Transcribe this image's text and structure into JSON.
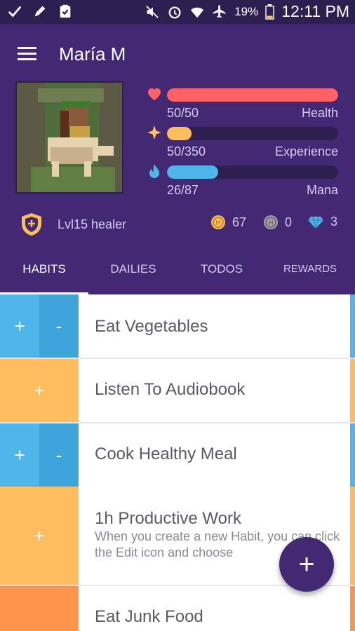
{
  "status_bar": {
    "battery_percent": "19%",
    "time": "12:11 PM"
  },
  "header": {
    "user_name": "María M",
    "stats": {
      "health": {
        "value": "50/50",
        "label": "Health",
        "fraction": 1.0,
        "color": "#ff6165"
      },
      "experience": {
        "value": "50/350",
        "label": "Experience",
        "fraction": 0.143,
        "color": "#ffbe5d"
      },
      "mana": {
        "value": "26/87",
        "label": "Mana",
        "fraction": 0.299,
        "color": "#50b5e9"
      }
    },
    "class_label": "Lvl15 healer",
    "gold": "67",
    "hourglasses": "0",
    "gems": "3"
  },
  "tabs": [
    "HABITS",
    "DAILIES",
    "TODOS",
    "REWARDS"
  ],
  "active_tab": "HABITS",
  "habits": [
    {
      "title": "Eat Vegetables",
      "plus": "+",
      "minus": "-",
      "color": "#50b5e9",
      "color_dark": "#3ea5dc"
    },
    {
      "title": "Listen To Audiobook",
      "plus": "+",
      "color": "#ffbe5d"
    },
    {
      "title": "Cook Healthy Meal",
      "plus": "+",
      "minus": "-",
      "color": "#50b5e9",
      "color_dark": "#3ea5dc"
    },
    {
      "title": "1h Productive Work",
      "plus": "+",
      "notes": "When you create a new Habit, you can click the Edit icon and choose",
      "color": "#ffbe5d"
    },
    {
      "title": "Eat Junk Food",
      "minus": "-",
      "color": "#ff944c"
    }
  ],
  "fab_label": "+",
  "colors": {
    "header": "#432874",
    "status_bar": "#2d1f4f",
    "bar_track": "#2d1f4f",
    "blue_habit": "#50b5e9",
    "yellow_habit": "#ffbe5d",
    "orange_habit": "#ff944c"
  }
}
